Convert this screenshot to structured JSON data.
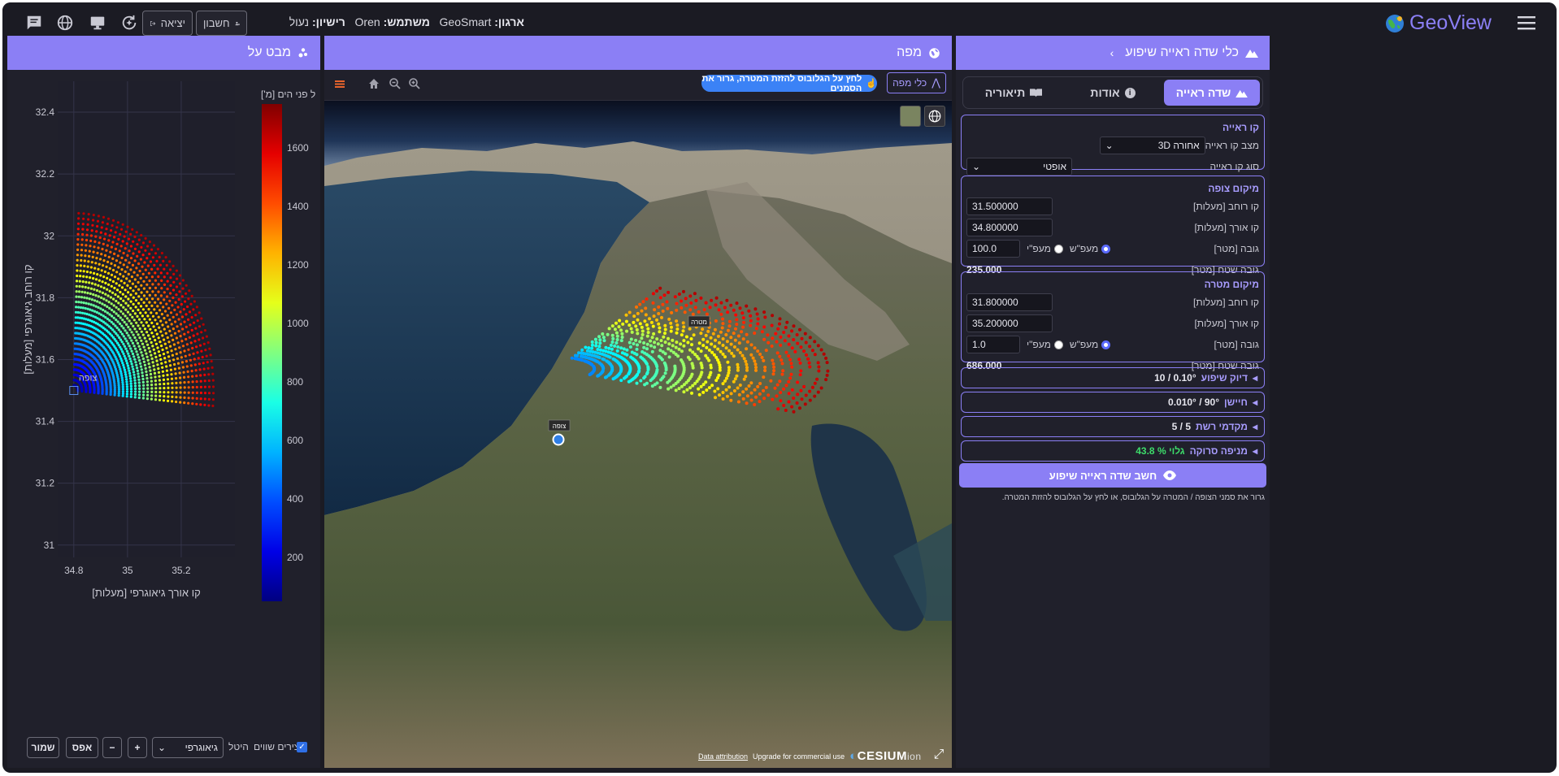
{
  "topbar": {
    "logout_label": "יציאה",
    "account_label": "חשבון",
    "license_label": "רישיון:",
    "license_value": "נעול",
    "user_label": "משתמש:",
    "user_value": "Oren",
    "org_label": "ארגון:",
    "org_value": "GeoSmart",
    "brand": "GeoView"
  },
  "sidepanel": {
    "title": "כלי שדה ראייה שיפוע",
    "tabs": [
      {
        "label": "שדה ראייה",
        "icon": "mountain-icon"
      },
      {
        "label": "אודות",
        "icon": "info-icon"
      },
      {
        "label": "תיאוריה",
        "icon": "book-icon"
      }
    ],
    "los": {
      "title": "קו ראייה",
      "mode_label": "מצב קו ראייה",
      "mode_value": "אחורה 3D",
      "type_label": "סוג קו ראייה",
      "type_value": "אופטי"
    },
    "observer": {
      "title": "מיקום צופה",
      "lat_label": "קו רוחב [מעלות]",
      "lat_value": "31.500000",
      "lon_label": "קו אורך [מעלות]",
      "lon_value": "34.800000",
      "height_label": "גובה [מטר]",
      "height_value": "100.0",
      "radio_msl": "מעפ\"ש",
      "radio_agl": "מעפ\"י",
      "ground_label": "גובה שטח [מטר]",
      "ground_value": "235.000"
    },
    "target": {
      "title": "מיקום מטרה",
      "lat_label": "קו רוחב [מעלות]",
      "lat_value": "31.800000",
      "lon_label": "קו אורך [מעלות]",
      "lon_value": "35.200000",
      "height_label": "גובה [מטר]",
      "height_value": "1.0",
      "radio_msl": "מעפ\"ש",
      "radio_agl": "מעפ\"י",
      "ground_label": "גובה שטח [מטר]",
      "ground_value": "686.000"
    },
    "accuracy": {
      "label": "דיוק שיפוע",
      "value": "0.10° / 10"
    },
    "sensor": {
      "label": "חיישן",
      "value": "90° / 0.010°"
    },
    "grid": {
      "label": "מקדמי רשת",
      "value": "5 / 5"
    },
    "scan": {
      "label": "מניפה סרוקה",
      "value": "גלוי % 43.8"
    },
    "compute_label": "חשב שדה ראייה שיפוע",
    "hint": "גרור את סמני הצופה / המטרה על הגלובוס, או לחץ על הגלובוס להזזת המטרה."
  },
  "map": {
    "title": "מפה",
    "tools_label": "כלי מפה",
    "hint_pill": "לחץ על הגלובוס להזזת המטרה, גרור את הסמנים",
    "target_tag": "מטרה",
    "observer_tag": "צופה",
    "attribution": "Data attribution",
    "upgrade": "Upgrade for commercial use",
    "cesium": "CESIUM",
    "ion": "ion"
  },
  "plot": {
    "title": "מבט על",
    "colorbar_title": "ל פני הים [מ']",
    "observer_label": "צופה",
    "equal_axes_label": "צירים שווים",
    "layer_label": "היטל",
    "layer_value": "גיאוגרפי",
    "plus": "+",
    "minus": "−",
    "reset": "אפס",
    "save": "שמור"
  },
  "chart_data": {
    "type": "scatter",
    "title": "מבט על",
    "xlabel": "קו אורך גיאוגרפי [מעלות]",
    "ylabel": "קו רוחב גיאוגרפי [מעלות]",
    "xlim": [
      34.74,
      35.4
    ],
    "ylim": [
      30.96,
      32.5
    ],
    "x_ticks": [
      "34.8",
      "35",
      "35.2"
    ],
    "y_ticks": [
      "31",
      "31.2",
      "31.4",
      "31.6",
      "31.8",
      "32",
      "32.2",
      "32.4"
    ],
    "colorbar": {
      "title": "ל פני הים [מ']",
      "range": [
        50,
        1750
      ],
      "ticks": [
        "200",
        "400",
        "600",
        "800",
        "1000",
        "1200",
        "1400",
        "1600"
      ]
    },
    "fan": {
      "origin_lon": 34.8,
      "origin_lat": 31.5,
      "bearing_from_deg": 2,
      "bearing_to_deg": 95,
      "rings": 34,
      "rays": 46
    },
    "grid": true,
    "legend": "none"
  },
  "colors": {
    "accent": "#8b7ff5",
    "background": "#1b1b23",
    "panel": "#20202b"
  }
}
